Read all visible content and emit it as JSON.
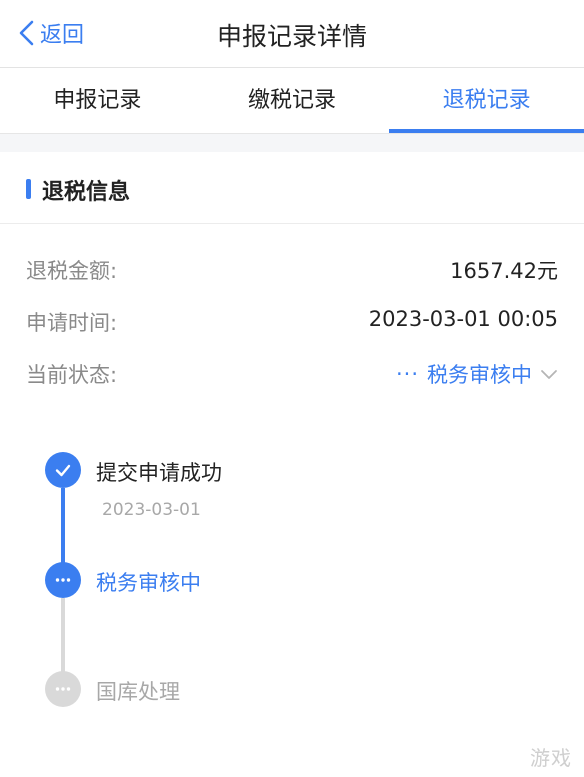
{
  "header": {
    "back_label": "返回",
    "title": "申报记录详情"
  },
  "tabs": [
    {
      "label": "申报记录",
      "active": false
    },
    {
      "label": "缴税记录",
      "active": false
    },
    {
      "label": "退税记录",
      "active": true
    }
  ],
  "section": {
    "title": "退税信息"
  },
  "info": {
    "amount": {
      "label": "退税金额:",
      "value": "1657.42元"
    },
    "apply_time": {
      "label": "申请时间:",
      "value": "2023-03-01 00:05"
    },
    "status": {
      "label": "当前状态:",
      "dots": "···",
      "value": "税务审核中"
    }
  },
  "timeline": [
    {
      "label": "提交申请成功",
      "date": "2023-03-01",
      "state": "done"
    },
    {
      "label": "税务审核中",
      "date": "",
      "state": "current"
    },
    {
      "label": "国库处理",
      "date": "",
      "state": "pending"
    }
  ],
  "watermark": "游戏",
  "colors": {
    "accent": "#3b7ef0",
    "muted": "#8a8a8a",
    "pending": "#d9d9d9"
  }
}
